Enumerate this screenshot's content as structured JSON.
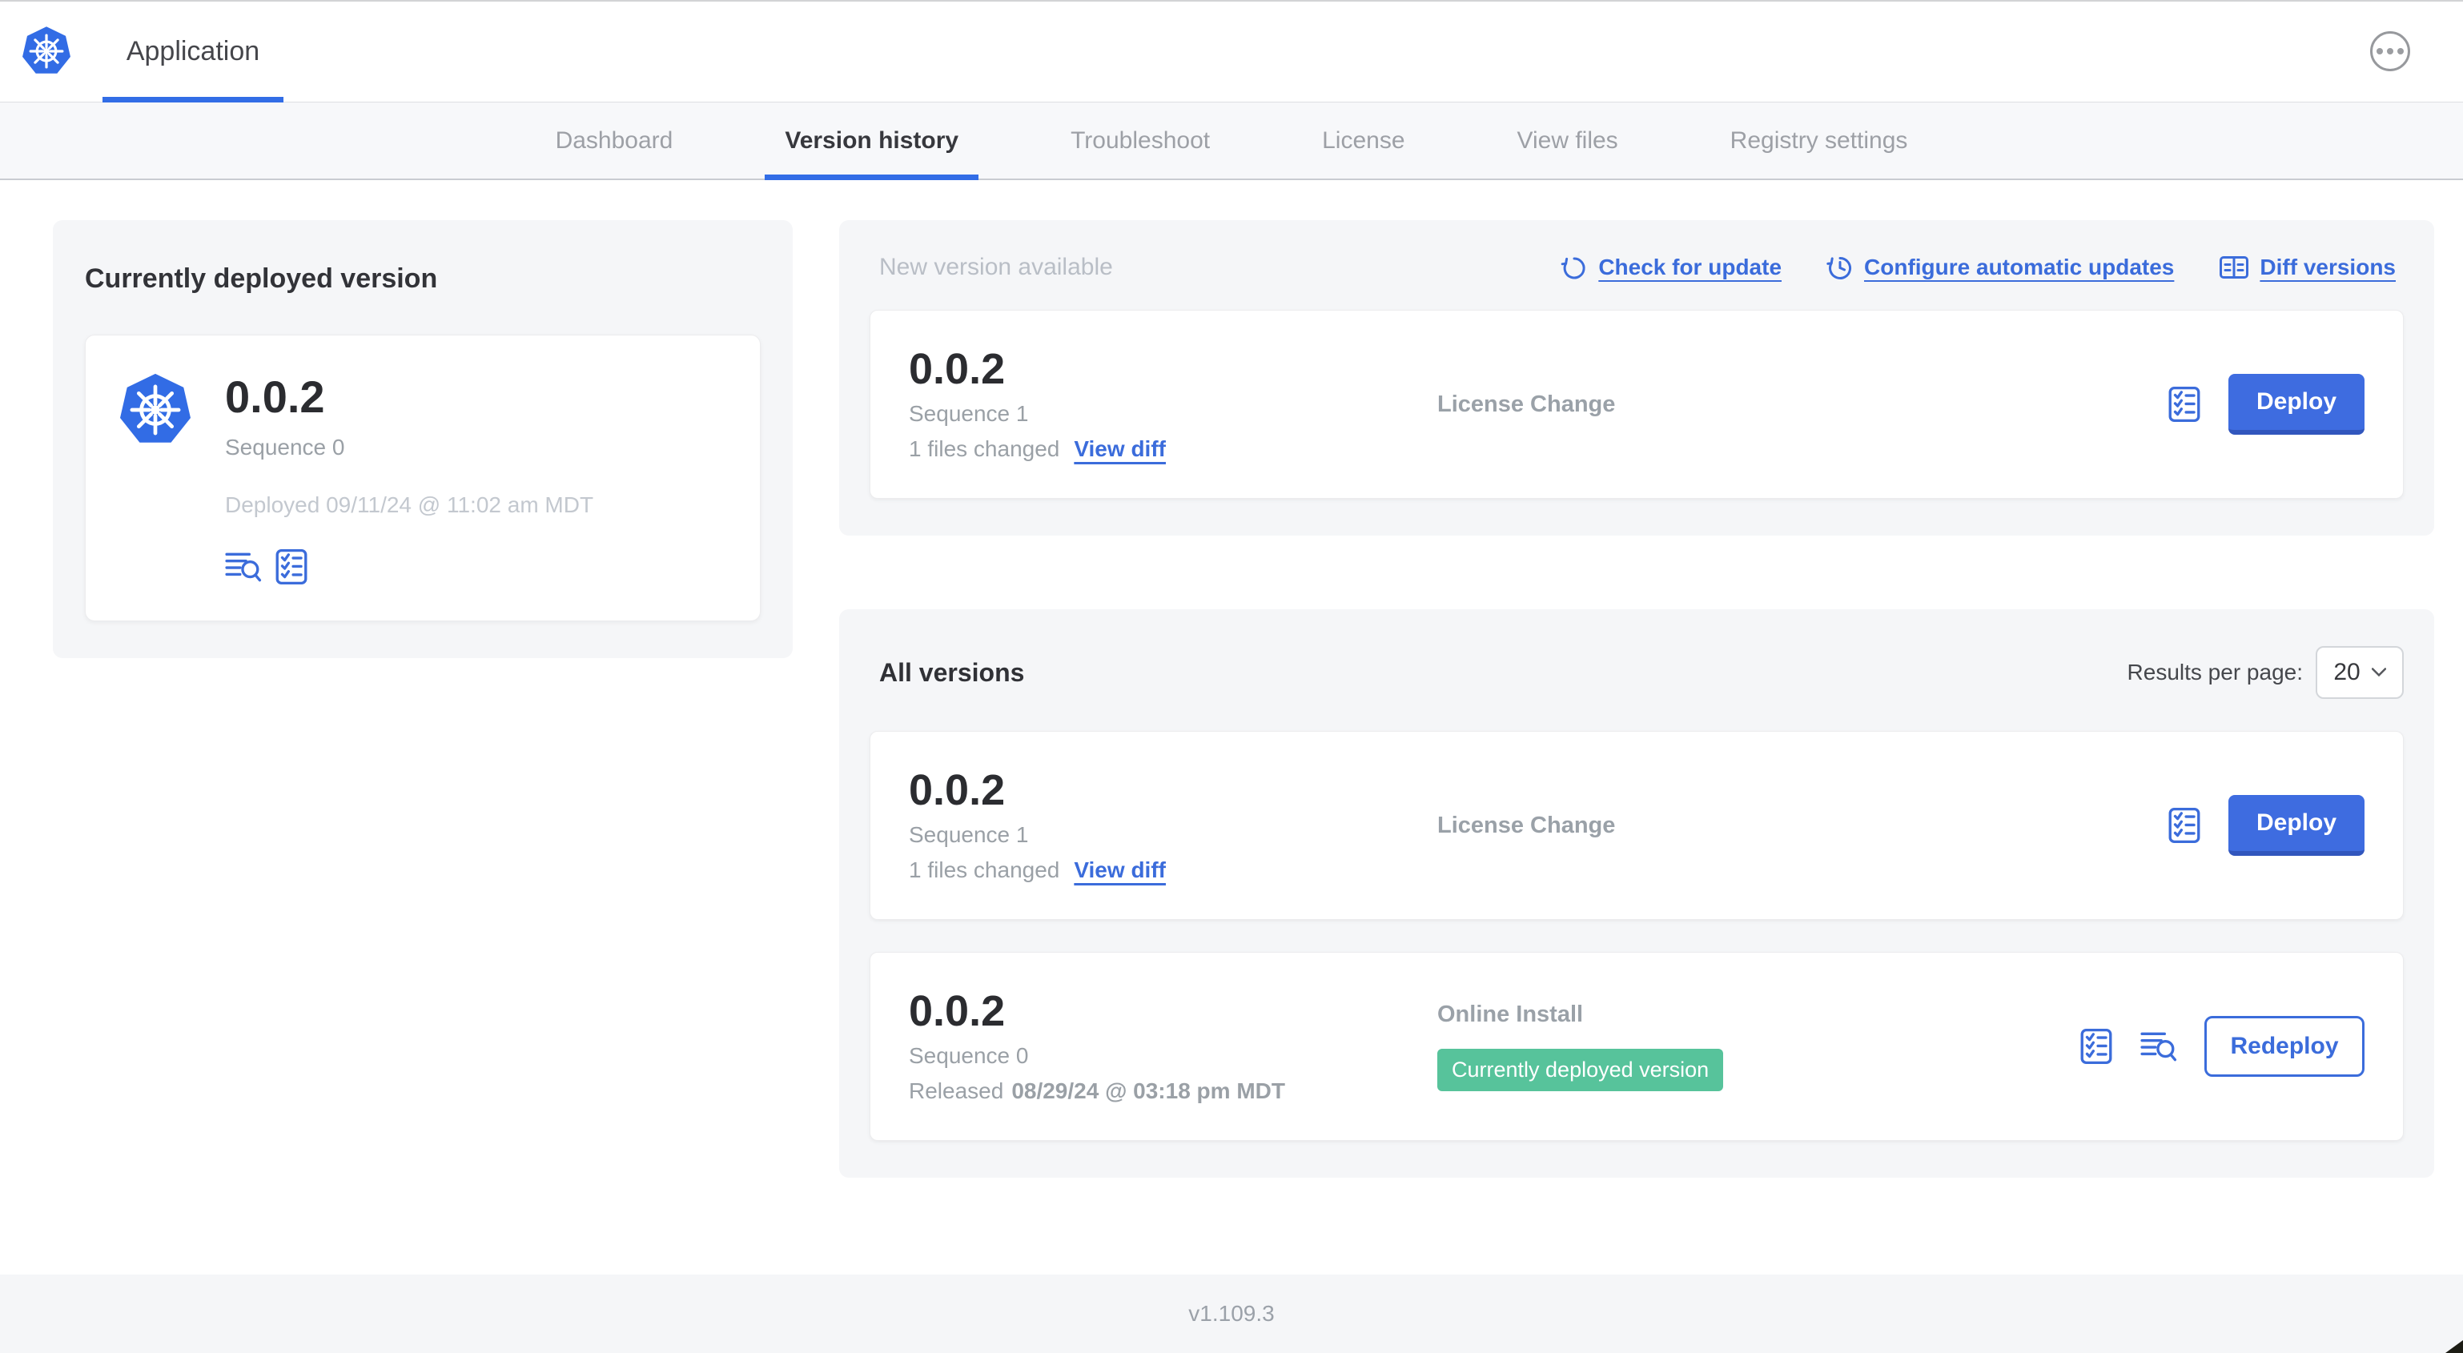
{
  "header": {
    "app_tab": "Application",
    "more_icon": "ellipsis-icon"
  },
  "nav": {
    "tabs": [
      {
        "label": "Dashboard",
        "active": false
      },
      {
        "label": "Version history",
        "active": true
      },
      {
        "label": "Troubleshoot",
        "active": false
      },
      {
        "label": "License",
        "active": false
      },
      {
        "label": "View files",
        "active": false
      },
      {
        "label": "Registry settings",
        "active": false
      }
    ]
  },
  "current_version_panel": {
    "title": "Currently deployed version",
    "version": "0.0.2",
    "sequence": "Sequence 0",
    "deployed": "Deployed 09/11/24 @ 11:02 am MDT",
    "icons": [
      "logs-icon",
      "preflight-checks-icon"
    ]
  },
  "new_version_panel": {
    "title": "New version available",
    "actions": [
      {
        "label": "Check for update",
        "icon": "refresh-icon"
      },
      {
        "label": "Configure automatic updates",
        "icon": "schedule-update-icon"
      },
      {
        "label": "Diff versions",
        "icon": "diff-icon"
      }
    ],
    "card": {
      "version": "0.0.2",
      "sequence": "Sequence 1",
      "files_changed": "1 files changed",
      "view_diff": "View diff",
      "source": "License Change",
      "deploy_label": "Deploy",
      "icons": [
        "preflight-checks-icon"
      ]
    }
  },
  "all_versions_panel": {
    "title": "All versions",
    "results_per_page_label": "Results per page:",
    "results_per_page_value": "20",
    "rows": [
      {
        "version": "0.0.2",
        "sequence": "Sequence 1",
        "files_changed": "1 files changed",
        "view_diff": "View diff",
        "source": "License Change",
        "action": "Deploy",
        "icons": [
          "preflight-checks-icon"
        ]
      },
      {
        "version": "0.0.2",
        "sequence": "Sequence 0",
        "released_prefix": "Released",
        "released_date": "08/29/24 @ 03:18 pm MDT",
        "source": "Online Install",
        "badge": "Currently deployed version",
        "action": "Redeploy",
        "icons": [
          "preflight-checks-icon",
          "logs-icon"
        ]
      }
    ]
  },
  "footer": {
    "version": "v1.109.3"
  },
  "colors": {
    "accent_blue": "#326de6",
    "link_blue": "#3b6cdb",
    "button_blue": "#3e6ce0",
    "button_blue_shade": "#3156bd",
    "badge_green": "#57c39b",
    "panel_gray": "#f5f6f8"
  }
}
